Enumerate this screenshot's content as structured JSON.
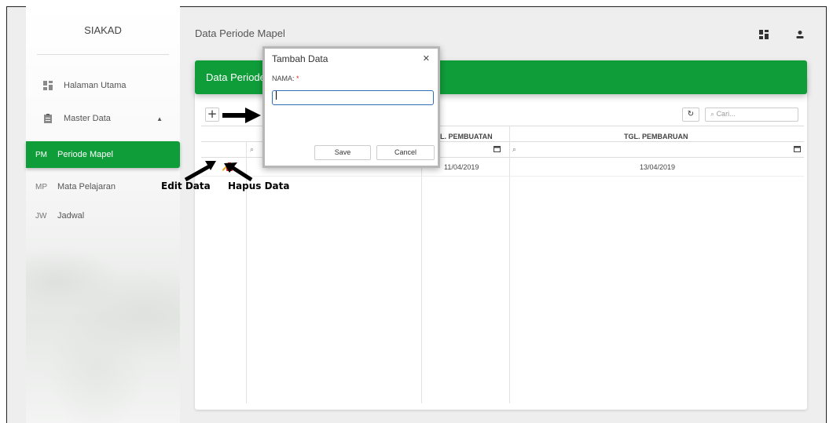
{
  "sidebar": {
    "brand": "SIAKAD",
    "items": [
      {
        "abbr": "",
        "icon": "dashboard-icon",
        "label": "Halaman Utama"
      },
      {
        "abbr": "",
        "icon": "clipboard-icon",
        "label": "Master Data"
      },
      {
        "abbr": "PM",
        "label": "Periode Mapel",
        "active": true
      },
      {
        "abbr": "MP",
        "label": "Mata Pelajaran"
      },
      {
        "abbr": "JW",
        "label": "Jadwal"
      }
    ]
  },
  "header": {
    "title": "Data Periode Mapel"
  },
  "card": {
    "title": "Data Periode",
    "search_placeholder": "Cari...",
    "columns": [
      "TGL. PEMBUATAN",
      "TGL. PEMBARUAN"
    ],
    "column_first_partial": "L. PEMBUATAN",
    "rows": [
      {
        "created": "11/04/2019",
        "updated": "13/04/2019"
      }
    ]
  },
  "annotations": {
    "edit": "Edit Data",
    "delete": "Hapus Data"
  },
  "modal": {
    "title": "Tambah Data",
    "field_label": "NAMA:",
    "required_mark": "*",
    "input_value": "",
    "save_label": "Save",
    "cancel_label": "Cancel"
  },
  "colors": {
    "accent": "#0f9d3a",
    "danger": "#e02424",
    "edit": "#f5a623"
  }
}
